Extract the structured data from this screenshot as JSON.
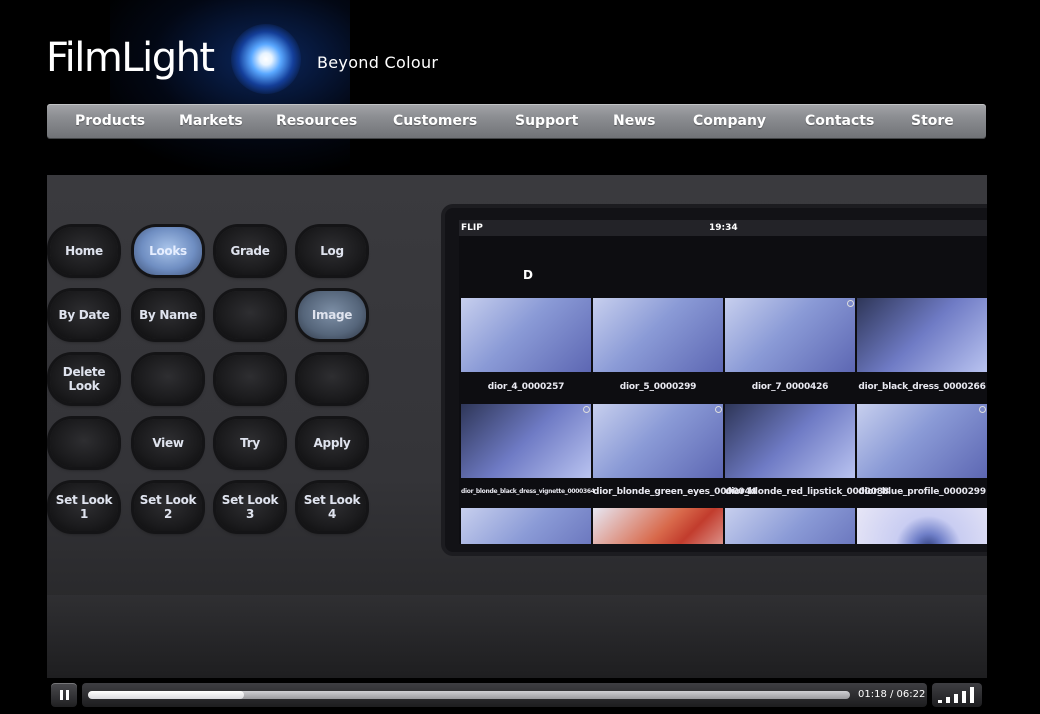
{
  "brand": {
    "name": "FilmLight",
    "tagline": "Beyond Colour"
  },
  "nav": {
    "items": [
      {
        "label": "Products"
      },
      {
        "label": "Markets"
      },
      {
        "label": "Resources"
      },
      {
        "label": "Customers"
      },
      {
        "label": "Support"
      },
      {
        "label": "News"
      },
      {
        "label": "Company"
      },
      {
        "label": "Contacts"
      },
      {
        "label": "Store"
      }
    ]
  },
  "video": {
    "panel_keys": [
      {
        "label": "Home"
      },
      {
        "label": "Looks"
      },
      {
        "label": "Grade"
      },
      {
        "label": "Log"
      },
      {
        "label": "By Date"
      },
      {
        "label": "By Name"
      },
      {
        "label": ""
      },
      {
        "label": "Image"
      },
      {
        "label": "Delete Look"
      },
      {
        "label": ""
      },
      {
        "label": ""
      },
      {
        "label": ""
      },
      {
        "label": ""
      },
      {
        "label": "View"
      },
      {
        "label": "Try"
      },
      {
        "label": "Apply"
      },
      {
        "label": "Set Look 1"
      },
      {
        "label": "Set Look 2"
      },
      {
        "label": "Set Look 3"
      },
      {
        "label": "Set Look 4"
      }
    ],
    "screen": {
      "app_name": "FLIP",
      "clock": "19:34",
      "section_letter": "D",
      "thumbnails": [
        {
          "caption": "dior_4_0000257"
        },
        {
          "caption": "dior_5_0000299"
        },
        {
          "caption": "dior_7_0000426"
        },
        {
          "caption": "dior_black_dress_0000266"
        },
        {
          "caption": "dior_blonde_black_dress_vignette_0000364"
        },
        {
          "caption": "dior_blonde_green_eyes_0000044"
        },
        {
          "caption": "dior_blonde_red_lipstick_0000088"
        },
        {
          "caption": "dior_blue_profile_0000299"
        }
      ]
    }
  },
  "player": {
    "time_display": "01:18 / 06:22",
    "progress_fraction": 0.205,
    "volume_level_bars": 5
  },
  "colors": {
    "nav_bar": "#8d8f93",
    "background": "#000000",
    "key_lit": "#6f8ec2"
  }
}
